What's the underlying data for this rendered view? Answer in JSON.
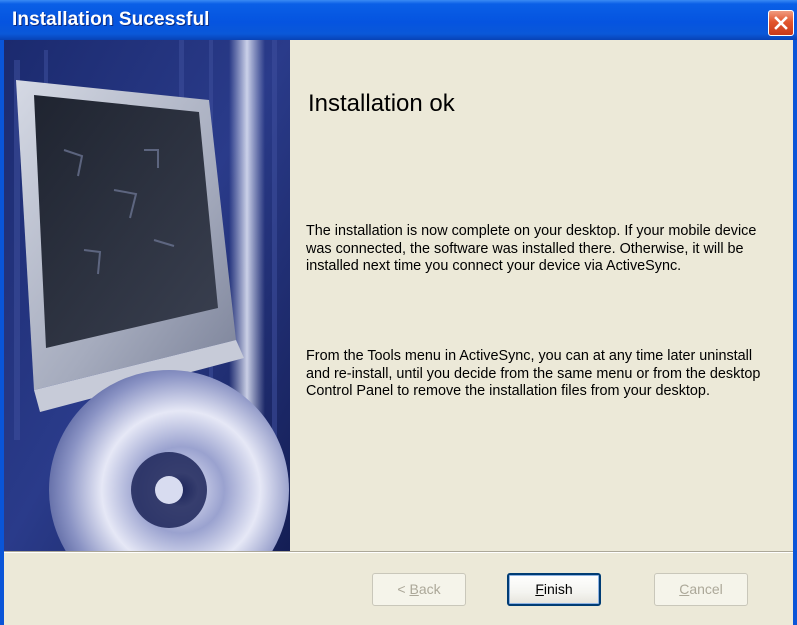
{
  "window": {
    "title": "Installation Sucessful"
  },
  "content": {
    "heading": "Installation ok",
    "paragraph1": "The installation is now complete on your desktop. If your mobile device was connected, the software was installed there. Otherwise, it will be installed next time you connect your device via ActiveSync.",
    "paragraph2": "From the Tools menu in ActiveSync, you can at any time later uninstall and re-install, until you decide from the same menu or from the desktop Control Panel to remove the installation files from your desktop."
  },
  "buttons": {
    "back": {
      "prefix": "< ",
      "accel": "B",
      "rest": "ack",
      "enabled": false
    },
    "finish": {
      "prefix": "",
      "accel": "F",
      "rest": "inish",
      "enabled": true
    },
    "cancel": {
      "prefix": "",
      "accel": "C",
      "rest": "ancel",
      "enabled": false
    }
  },
  "colors": {
    "titlebar": "#0554e0",
    "dialog_background": "#ece9d8",
    "close_button": "#e2562d",
    "button_border": "#003c74"
  },
  "icons": {
    "close": "close-icon",
    "banner": "monitor-cd-banner-image"
  }
}
